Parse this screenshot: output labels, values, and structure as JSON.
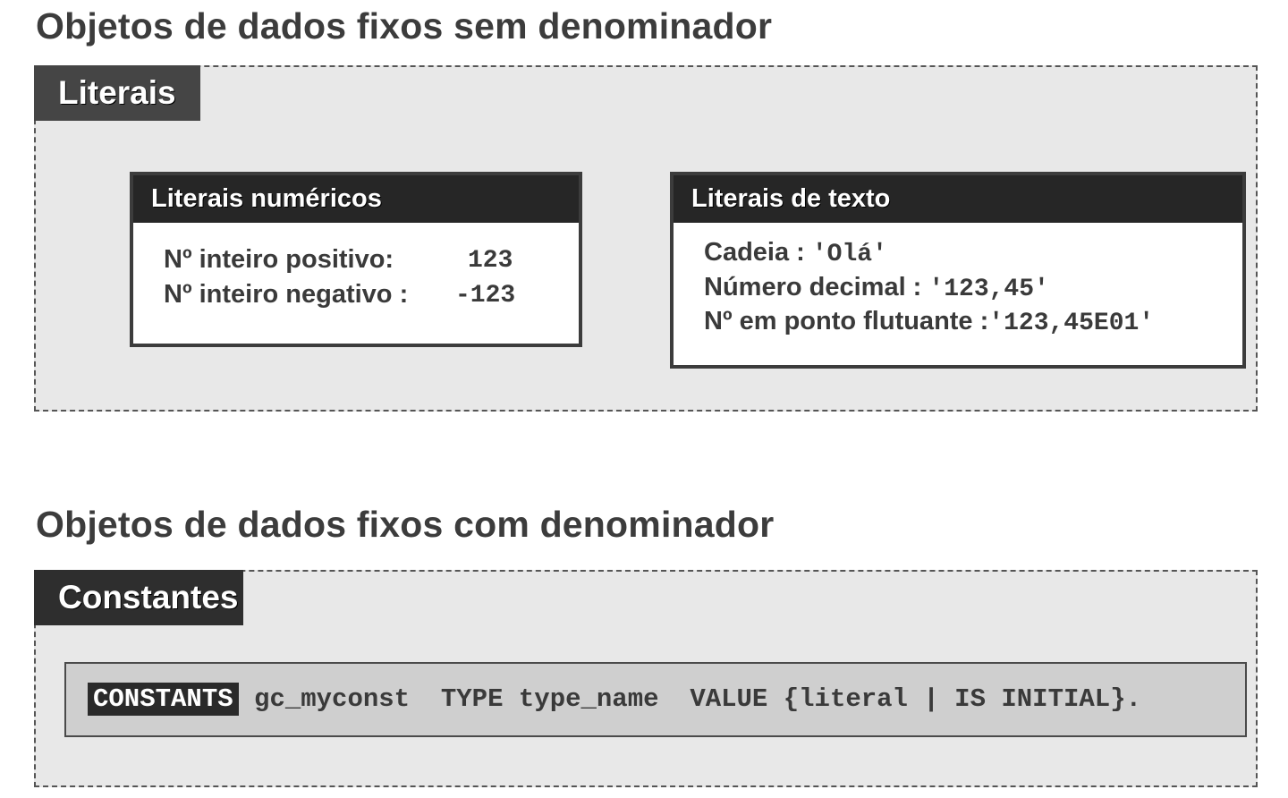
{
  "section_1": {
    "title": "Objetos de dados fixos sem denominador",
    "tab": "Literais",
    "numeric_card": {
      "header": "Literais numéricos",
      "rows": [
        {
          "label": "Nº inteiro positivo:",
          "value": "123"
        },
        {
          "label": "Nº inteiro negativo :",
          "value": "-123"
        }
      ]
    },
    "text_card": {
      "header": "Literais de texto",
      "rows": [
        {
          "label": "Cadeia : ",
          "value": "'Olá'"
        },
        {
          "label": "Número decimal : ",
          "value": "'123,45'"
        },
        {
          "label": "Nº em ponto flutuante :",
          "value": "'123,45E01'"
        }
      ]
    }
  },
  "section_2": {
    "title": "Objetos de dados fixos com denominador",
    "tab": "Constantes",
    "code": {
      "keyword": "CONSTANTS",
      "rest": " gc_myconst  TYPE type_name  VALUE {literal | IS INITIAL}."
    }
  }
}
